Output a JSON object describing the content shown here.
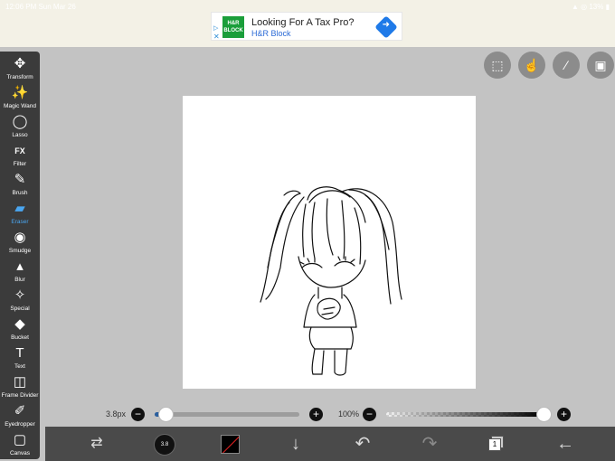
{
  "status": {
    "time": "12:06 PM  Sun Mar 26",
    "right": "▲ ◎ 13% ▮"
  },
  "ad": {
    "logo": "H&R BLOCK",
    "adchoice": "▷",
    "adclose": "✕",
    "title": "Looking For A Tax Pro?",
    "sub": "H&R Block",
    "go": "➜"
  },
  "toolbar": [
    {
      "id": "transform",
      "label": "Transform",
      "icon": "✥",
      "icon_name": "move-arrows-icon"
    },
    {
      "id": "magic-wand",
      "label": "Magic Wand",
      "icon": "✨",
      "icon_name": "magic-wand-icon"
    },
    {
      "id": "lasso",
      "label": "Lasso",
      "icon": "◯",
      "icon_name": "lasso-icon"
    },
    {
      "id": "filter",
      "label": "Filter",
      "icon": "FX",
      "icon_name": "fx-icon"
    },
    {
      "id": "brush",
      "label": "Brush",
      "icon": "✎",
      "icon_name": "brush-icon"
    },
    {
      "id": "eraser",
      "label": "Eraser",
      "icon": "▰",
      "icon_name": "eraser-icon",
      "active": true
    },
    {
      "id": "smudge",
      "label": "Smudge",
      "icon": "◉",
      "icon_name": "smudge-icon"
    },
    {
      "id": "blur",
      "label": "Blur",
      "icon": "▴",
      "icon_name": "blur-drop-icon"
    },
    {
      "id": "special",
      "label": "Special",
      "icon": "✧",
      "icon_name": "special-icon"
    },
    {
      "id": "bucket",
      "label": "Bucket",
      "icon": "◆",
      "icon_name": "bucket-icon"
    },
    {
      "id": "text",
      "label": "Text",
      "icon": "T",
      "icon_name": "text-icon"
    },
    {
      "id": "frame-divider",
      "label": "Frame Divider",
      "icon": "◫",
      "icon_name": "frame-divider-icon"
    },
    {
      "id": "eyedropper",
      "label": "Eyedropper",
      "icon": "✐",
      "icon_name": "eyedropper-icon"
    },
    {
      "id": "canvas",
      "label": "Canvas",
      "icon": "▢",
      "icon_name": "canvas-icon"
    }
  ],
  "top_buttons": [
    {
      "id": "selection",
      "icon": "⬚",
      "icon_name": "selection-icon"
    },
    {
      "id": "hand",
      "icon": "☝",
      "icon_name": "hand-touch-icon"
    },
    {
      "id": "ruler",
      "icon": "∕",
      "icon_name": "ruler-icon"
    },
    {
      "id": "image",
      "icon": "▣",
      "icon_name": "image-icon"
    }
  ],
  "brush_size": {
    "label": "3.8px",
    "value": 0.08,
    "minus": "−",
    "plus": "+"
  },
  "opacity": {
    "label": "100%",
    "value": 1.0,
    "minus": "−",
    "plus": "+"
  },
  "bottom": {
    "swap_icon": "⇄",
    "brush_preview": "3.8",
    "color": "#000000",
    "down_icon": "↓",
    "undo_icon": "↶",
    "redo_icon": "↷",
    "layer_count": "1",
    "back_icon": "←"
  }
}
